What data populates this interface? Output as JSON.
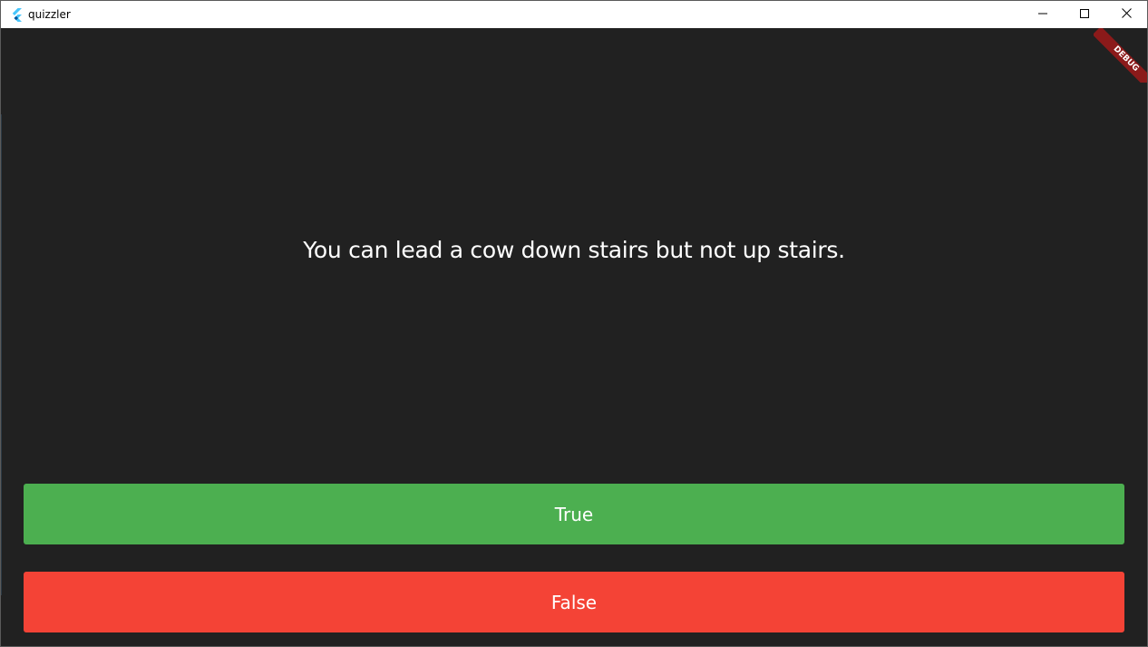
{
  "window": {
    "title": "quizzler",
    "icon": "flutter-logo-icon",
    "controls": {
      "minimize": "minimize-icon",
      "maximize": "maximize-icon",
      "close": "close-icon"
    }
  },
  "debug_banner": {
    "label": "DEBUG",
    "color": "#8b1a1a"
  },
  "quiz": {
    "question": "You can lead a cow down stairs but not up stairs.",
    "true_label": "True",
    "false_label": "False"
  },
  "colors": {
    "background": "#212121",
    "true_button": "#4caf50",
    "false_button": "#f44336"
  }
}
